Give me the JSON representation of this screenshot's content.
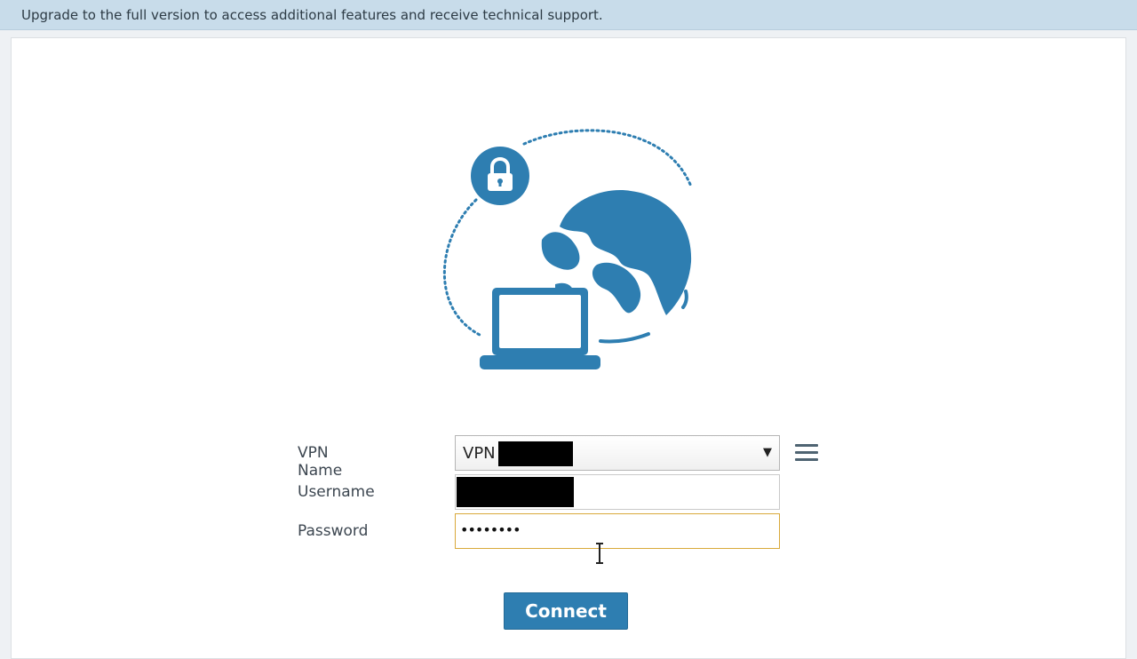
{
  "banner": {
    "text": "Upgrade to the full version to access additional features and receive technical support."
  },
  "hero": {
    "icons": [
      "lock-icon",
      "globe-icon",
      "laptop-icon"
    ],
    "accent": "#2e7eb1"
  },
  "form": {
    "vpn_name_label": "VPN Name",
    "vpn_name_value": "VPN",
    "username_label": "Username",
    "password_label": "Password",
    "password_value": "••••••••",
    "menu_icon": "hamburger-menu-icon",
    "connect_label": "Connect"
  },
  "colors": {
    "banner_bg": "#c8dcea",
    "button_bg": "#2e7eb1",
    "focus_border": "#d9a93a"
  }
}
